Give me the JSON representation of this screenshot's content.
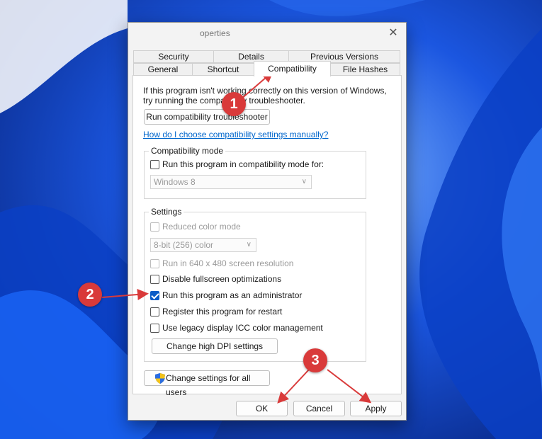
{
  "window": {
    "title": "operties",
    "close_glyph": "✕"
  },
  "tabs": {
    "row1": [
      "Security",
      "Details",
      "Previous Versions"
    ],
    "row2": [
      "General",
      "Shortcut",
      "Compatibility",
      "File Hashes"
    ],
    "active": "Compatibility"
  },
  "compatibility": {
    "intro_line1": "If this program isn't working correctly on this version of Windows,",
    "intro_line2": "try running the compatibility troubleshooter.",
    "troubleshooter_button": "Run compatibility troubleshooter",
    "help_link": "How do I choose compatibility settings manually?",
    "mode_group": {
      "legend": "Compatibility mode",
      "checkbox_label": "Run this program in compatibility mode for:",
      "checked": false,
      "select_value": "Windows 8"
    },
    "settings_group": {
      "legend": "Settings",
      "reduced_color": {
        "label": "Reduced color mode",
        "checked": false,
        "disabled": true
      },
      "color_select_value": "8-bit (256) color",
      "resolution_640": {
        "label": "Run in 640 x 480 screen resolution",
        "checked": false,
        "disabled": true
      },
      "disable_fullscreen": {
        "label": "Disable fullscreen optimizations",
        "checked": false
      },
      "run_as_admin": {
        "label": "Run this program as an administrator",
        "checked": true
      },
      "register_restart": {
        "label": "Register this program for restart",
        "checked": false
      },
      "legacy_icc": {
        "label": "Use legacy display ICC color management",
        "checked": false
      },
      "dpi_button": "Change high DPI settings"
    },
    "all_users_button": "Change settings for all users"
  },
  "footer": {
    "ok": "OK",
    "cancel": "Cancel",
    "apply": "Apply"
  },
  "annotations": {
    "badge1": "1",
    "badge2": "2",
    "badge3": "3",
    "color": "#d93a3a"
  },
  "icons": {
    "close": "close-icon",
    "shield": "uac-shield-icon",
    "chevron": "chevron-down-icon"
  }
}
